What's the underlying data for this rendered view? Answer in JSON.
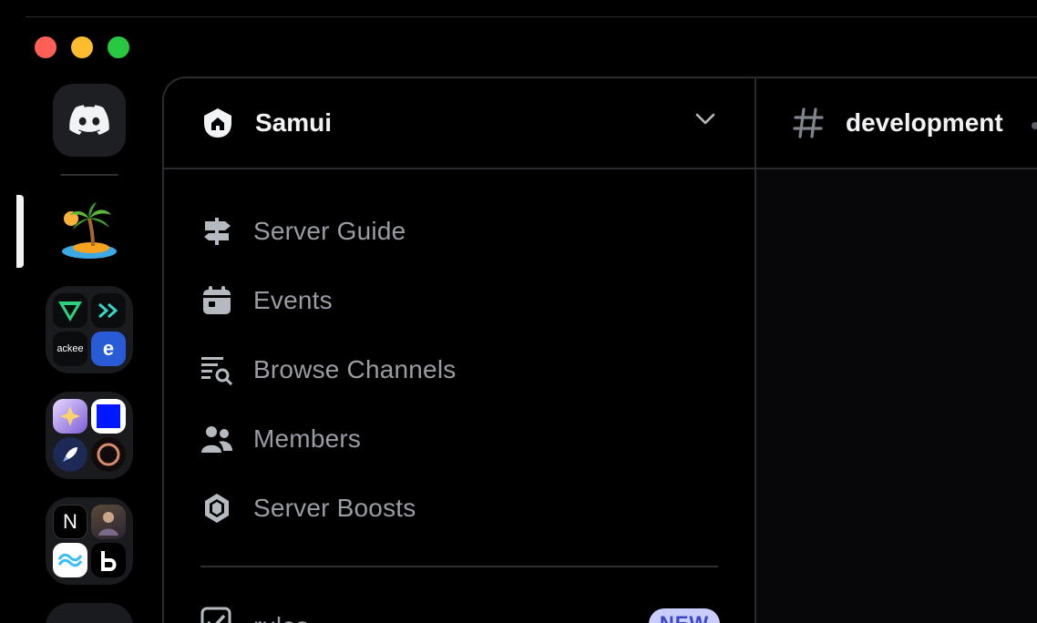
{
  "window": {
    "controls": [
      "close",
      "minimize",
      "maximize"
    ]
  },
  "rail": {
    "home_icon": "discord-logo-icon",
    "folder1": [
      "ackee",
      "e"
    ],
    "folder3": [
      "N"
    ]
  },
  "server": {
    "name": "Samui",
    "icon": "home-icon"
  },
  "menu": {
    "items": [
      {
        "label": "Server Guide",
        "icon": "signpost-icon"
      },
      {
        "label": "Events",
        "icon": "calendar-icon"
      },
      {
        "label": "Browse Channels",
        "icon": "browse-channels-icon"
      },
      {
        "label": "Members",
        "icon": "members-icon"
      },
      {
        "label": "Server Boosts",
        "icon": "boost-gem-icon"
      }
    ]
  },
  "channel_row": {
    "label": "rules",
    "badge": "NEW"
  },
  "main": {
    "channel": "development",
    "channel_icon": "hashtag-icon"
  },
  "colors": {
    "accent_badge_bg": "#c9cdfb",
    "accent_badge_fg": "#3c45c5",
    "muted_text": "#9a9ca3"
  }
}
